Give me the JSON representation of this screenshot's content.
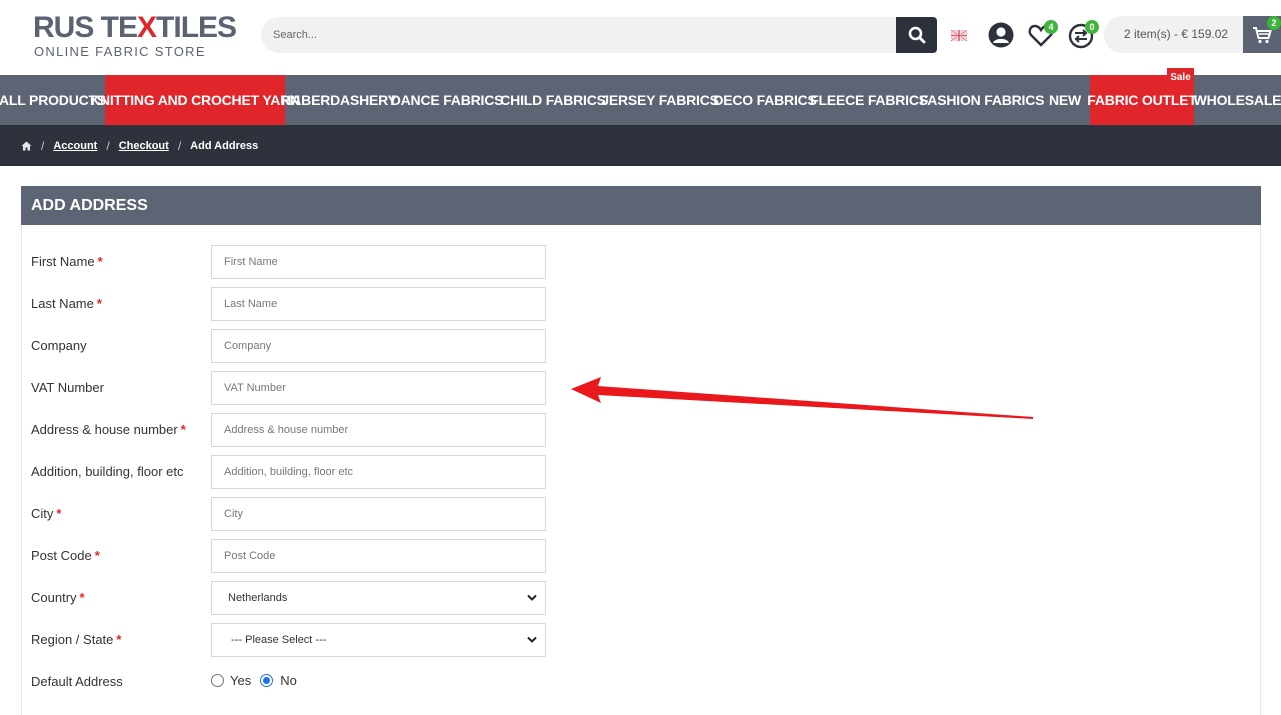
{
  "brand": {
    "logo_part1": "RUS TE",
    "logo_x": "X",
    "logo_part2": "TILES",
    "tagline": "ONLINE FABRIC STORE",
    "accent_color": "#e0262b",
    "nav_color": "#5d6474",
    "dark_color": "#2e323d"
  },
  "search": {
    "placeholder": "Search...",
    "icon": "search-icon"
  },
  "header_icons": {
    "language": "uk-flag-icon",
    "account": "user-icon",
    "wishlist": {
      "icon": "heart-icon",
      "count": "4"
    },
    "compare": {
      "icon": "compare-icon",
      "count": "0"
    }
  },
  "cart": {
    "summary": "2 item(s) - € 159.02",
    "count": "2",
    "icon": "cart-icon"
  },
  "nav": {
    "items": [
      "ALL PRODUCTS",
      "KNITTING AND CROCHET YARN",
      "HABERDASHERY",
      "DANCE FABRICS",
      "CHILD FABRICS",
      "JERSEY FABRICS",
      "DECO FABRICS",
      "FLEECE FABRICS",
      "FASHION FABRICS",
      "NEW",
      "FABRIC OUTLET",
      "WHOLESALE"
    ],
    "sale_tag": "Sale"
  },
  "breadcrumb": {
    "home_icon": "home-icon",
    "items": [
      "Account",
      "Checkout"
    ],
    "current": "Add Address"
  },
  "form": {
    "title": "ADD ADDRESS",
    "fields": [
      {
        "label": "First Name",
        "placeholder": "First Name",
        "required": "*"
      },
      {
        "label": "Last Name",
        "placeholder": "Last Name",
        "required": "*"
      },
      {
        "label": "Company",
        "placeholder": "Company",
        "required": ""
      },
      {
        "label": "VAT Number",
        "placeholder": "VAT Number",
        "required": ""
      },
      {
        "label": "Address & house number",
        "placeholder": "Address & house number",
        "required": "*"
      },
      {
        "label": "Addition, building, floor etc",
        "placeholder": "Addition, building, floor etc",
        "required": ""
      },
      {
        "label": "City",
        "placeholder": "City",
        "required": "*"
      },
      {
        "label": "Post Code",
        "placeholder": "Post Code",
        "required": "*"
      }
    ],
    "country": {
      "label": "Country",
      "required": "*",
      "value": "Netherlands"
    },
    "region": {
      "label": "Region / State",
      "required": "*",
      "value": " --- Please Select --- "
    },
    "default_address": {
      "label": "Default Address",
      "yes": "Yes",
      "no": "No",
      "selected": "No"
    }
  },
  "annotation": {
    "arrow_color": "#e8181d"
  }
}
